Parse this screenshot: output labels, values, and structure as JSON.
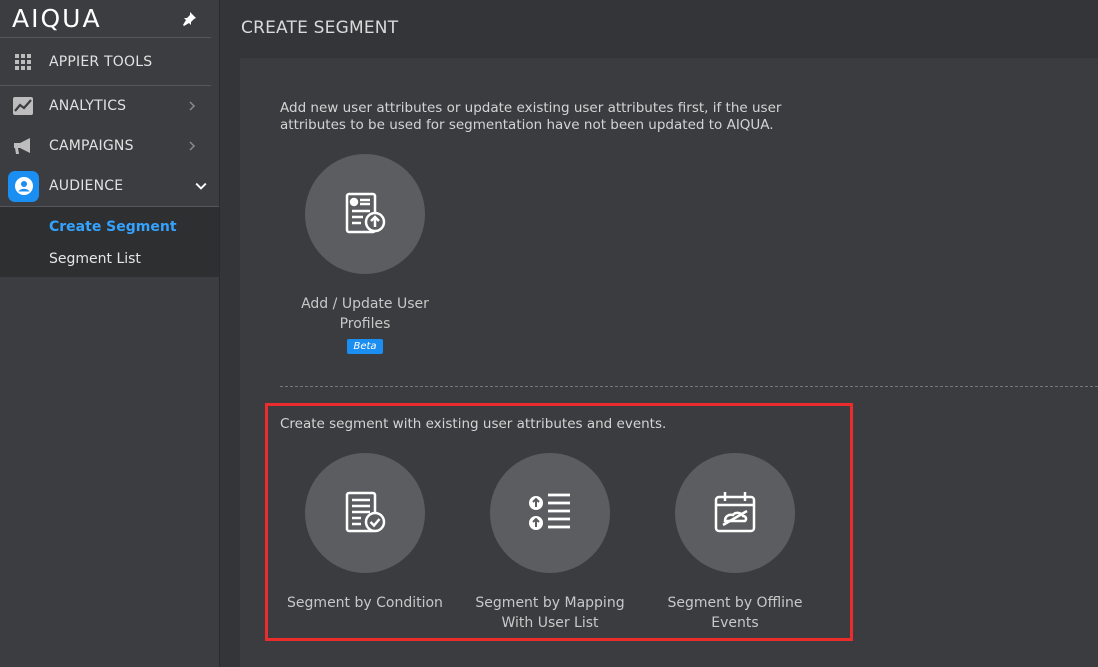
{
  "sidebar": {
    "logo": "AIQUA",
    "items": [
      {
        "label": "APPIER TOOLS",
        "icon": "grid-icon"
      },
      {
        "label": "ANALYTICS",
        "icon": "chart-icon"
      },
      {
        "label": "CAMPAIGNS",
        "icon": "megaphone-icon"
      },
      {
        "label": "AUDIENCE",
        "icon": "user-circle-icon"
      }
    ],
    "submenu": [
      {
        "label": "Create Segment",
        "current": true
      },
      {
        "label": "Segment List",
        "current": false
      }
    ],
    "accent_color": "#1b8ef2"
  },
  "main": {
    "title": "CREATE SEGMENT",
    "section1": {
      "intro": "Add new user attributes or update existing user attributes first, if the user attributes to be used for segmentation have not been updated to AIQUA.",
      "card": {
        "label": "Add / Update User Profiles",
        "badge": "Beta",
        "icon": "profile-upload-icon"
      }
    },
    "section2": {
      "intro": "Create segment with existing user attributes and events.",
      "cards": [
        {
          "label": "Segment by Condition",
          "icon": "document-check-icon"
        },
        {
          "label": "Segment by Mapping With User List",
          "icon": "list-upload-icon"
        },
        {
          "label": "Segment by Offline Events",
          "icon": "calendar-offline-icon"
        }
      ]
    },
    "highlight_color": "#ea2c2c"
  }
}
